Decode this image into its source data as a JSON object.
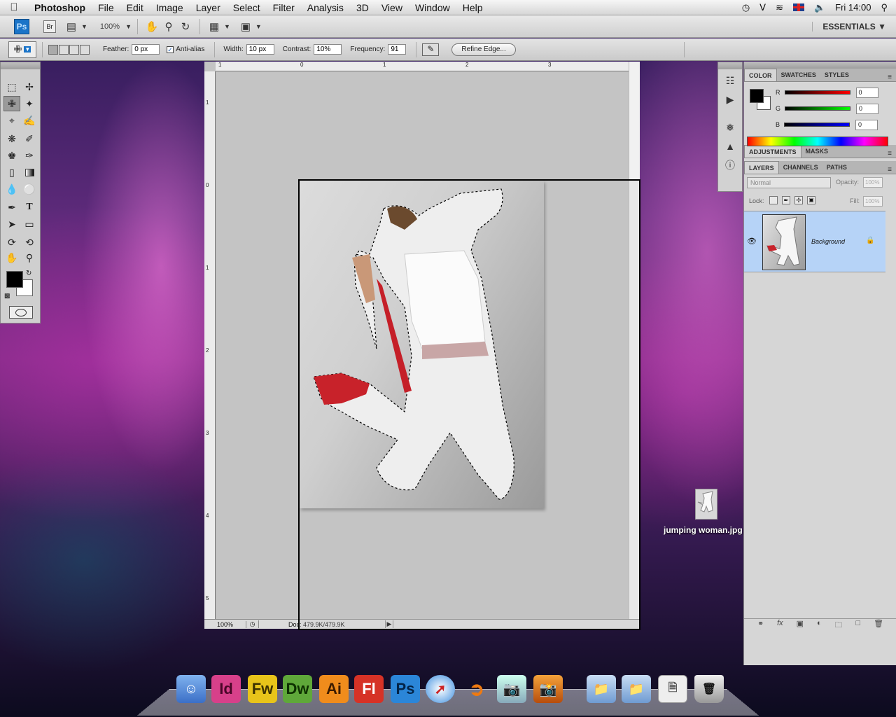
{
  "menubar": {
    "app_name": "Photoshop",
    "items": [
      "File",
      "Edit",
      "Image",
      "Layer",
      "Select",
      "Filter",
      "Analysis",
      "3D",
      "View",
      "Window",
      "Help"
    ],
    "clock": "Fri 14:00"
  },
  "appbar": {
    "ps_label": "Ps",
    "br_label": "Br",
    "zoom": "100%",
    "workspace": "ESSENTIALS"
  },
  "options": {
    "feather_label": "Feather:",
    "feather_value": "0 px",
    "antialias_label": "Anti-alias",
    "width_label": "Width:",
    "width_value": "10 px",
    "contrast_label": "Contrast:",
    "contrast_value": "10%",
    "frequency_label": "Frequency:",
    "frequency_value": "91",
    "refine_edge": "Refine Edge..."
  },
  "document": {
    "zoom": "100%",
    "doc_size": "Doc: 479.9K/479.9K",
    "ruler_h": [
      "1",
      "0",
      "1",
      "2",
      "3"
    ],
    "ruler_v": [
      "1",
      "0",
      "1",
      "2",
      "3",
      "4",
      "5"
    ]
  },
  "color_panel": {
    "tabs": [
      "COLOR",
      "SWATCHES",
      "STYLES"
    ],
    "r_label": "R",
    "r_value": "0",
    "g_label": "G",
    "g_value": "0",
    "b_label": "B",
    "b_value": "0"
  },
  "adjust_panel": {
    "tabs": [
      "ADJUSTMENTS",
      "MASKS"
    ]
  },
  "layers_panel": {
    "tabs": [
      "LAYERS",
      "CHANNELS",
      "PATHS"
    ],
    "blend_mode": "Normal",
    "opacity_label": "Opacity:",
    "opacity_value": "100%",
    "lock_label": "Lock:",
    "fill_label": "Fill:",
    "fill_value": "100%",
    "layer_name": "Background"
  },
  "desktop": {
    "file_icon_label": "jumping woman.jpg"
  },
  "dock": {
    "apps": [
      "Id",
      "Fw",
      "Dw",
      "Ai",
      "Fl",
      "Ps"
    ]
  },
  "colors": {
    "ps_blue": "#1b74c8",
    "indesign": "#d7408a",
    "fireworks": "#e8c41a",
    "dreamweaver": "#5fa83a",
    "illustrator": "#f08c1c",
    "flash": "#d63226",
    "photoshop": "#2b86d8",
    "selection_bg": "#b6d3f7"
  }
}
